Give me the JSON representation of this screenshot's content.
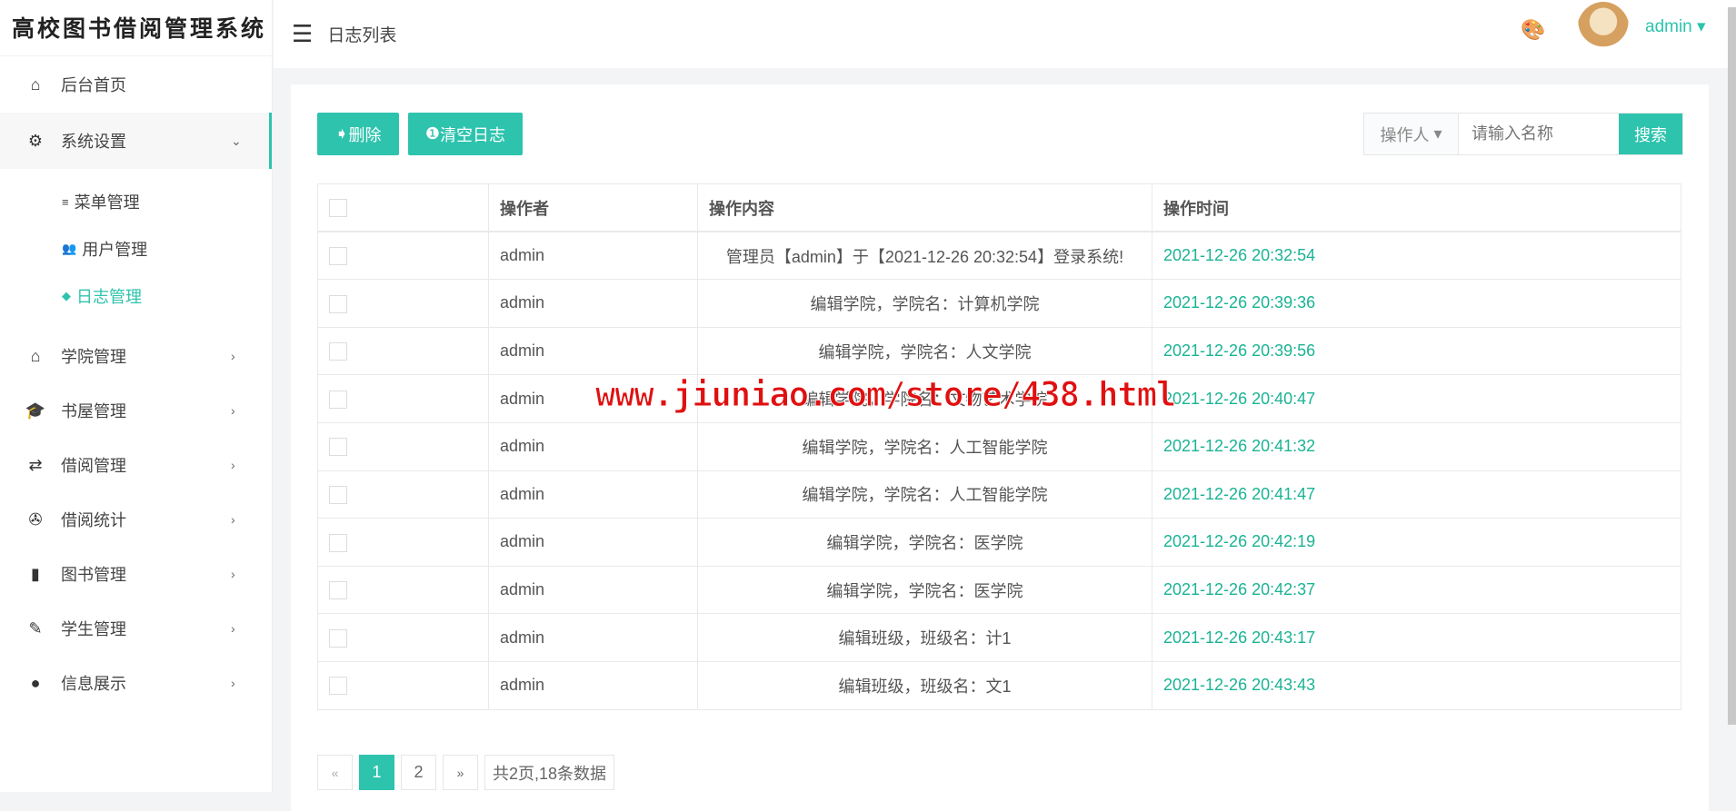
{
  "app_title": "高校图书借阅管理系统",
  "header": {
    "title": "日志列表",
    "user": "admin"
  },
  "sidebar": {
    "items": [
      {
        "label": "后台首页",
        "icon": "home-icon",
        "glyph": "⌂"
      },
      {
        "label": "系统设置",
        "icon": "gear-icon",
        "glyph": "⚙",
        "arrow": "⌄"
      },
      {
        "label": "学院管理",
        "icon": "building-icon",
        "glyph": "⌂",
        "arrow": "›"
      },
      {
        "label": "书屋管理",
        "icon": "graduation-cap-icon",
        "glyph": "🎓",
        "arrow": "›"
      },
      {
        "label": "借阅管理",
        "icon": "exchange-icon",
        "glyph": "⇄",
        "arrow": "›"
      },
      {
        "label": "借阅统计",
        "icon": "aperture-icon",
        "glyph": "✇",
        "arrow": "›"
      },
      {
        "label": "图书管理",
        "icon": "clipboard-icon",
        "glyph": "▮",
        "arrow": "›"
      },
      {
        "label": "学生管理",
        "icon": "pencil-icon",
        "glyph": "✎",
        "arrow": "›"
      },
      {
        "label": "信息展示",
        "icon": "user-icon",
        "glyph": "●",
        "arrow": "›"
      }
    ],
    "subitems": [
      {
        "label": "菜单管理",
        "glyph": "≡"
      },
      {
        "label": "用户管理",
        "glyph": "👥"
      },
      {
        "label": "日志管理",
        "glyph": "◆"
      }
    ]
  },
  "toolbar": {
    "delete": "删除",
    "clear": "清空日志",
    "search_field": "操作人",
    "search_placeholder": "请输入名称",
    "search": "搜索"
  },
  "table": {
    "headers": [
      "操作者",
      "操作内容",
      "操作时间"
    ],
    "rows": [
      [
        "admin",
        "管理员【admin】于【2021-12-26 20:32:54】登录系统!",
        "2021-12-26 20:32:54"
      ],
      [
        "admin",
        "编辑学院，学院名：计算机学院",
        "2021-12-26 20:39:36"
      ],
      [
        "admin",
        "编辑学院，学院名：人文学院",
        "2021-12-26 20:39:56"
      ],
      [
        "admin",
        "编辑学院，学院名：文物艺术学院",
        "2021-12-26 20:40:47"
      ],
      [
        "admin",
        "编辑学院，学院名：人工智能学院",
        "2021-12-26 20:41:32"
      ],
      [
        "admin",
        "编辑学院，学院名：人工智能学院",
        "2021-12-26 20:41:47"
      ],
      [
        "admin",
        "编辑学院，学院名：医学院",
        "2021-12-26 20:42:19"
      ],
      [
        "admin",
        "编辑学院，学院名：医学院",
        "2021-12-26 20:42:37"
      ],
      [
        "admin",
        "编辑班级，班级名：计1",
        "2021-12-26 20:43:17"
      ],
      [
        "admin",
        "编辑班级，班级名：文1",
        "2021-12-26 20:43:43"
      ]
    ]
  },
  "pagination": {
    "prev": "«",
    "pages": [
      "1",
      "2"
    ],
    "current": "1",
    "next": "»",
    "summary": "共2页,18条数据"
  },
  "watermark": "www.jiuniao.com/store/438.html"
}
